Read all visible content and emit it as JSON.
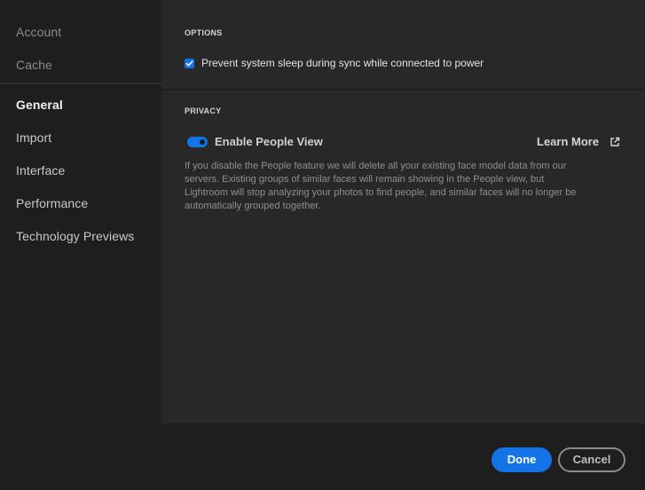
{
  "sidebar": {
    "items": [
      {
        "label": "Account",
        "state": "muted"
      },
      {
        "label": "Cache",
        "state": "muted"
      },
      {
        "label": "General",
        "state": "active"
      },
      {
        "label": "Import",
        "state": "normal"
      },
      {
        "label": "Interface",
        "state": "normal"
      },
      {
        "label": "Performance",
        "state": "normal"
      },
      {
        "label": "Technology Previews",
        "state": "normal"
      }
    ]
  },
  "options": {
    "title": "OPTIONS",
    "prevent_sleep": {
      "label": "Prevent system sleep during sync while connected to power",
      "checked": true
    }
  },
  "privacy": {
    "title": "PRIVACY",
    "people_view": {
      "label": "Enable People View",
      "enabled": true
    },
    "learn_more": "Learn More",
    "description": "If you disable the People feature we will delete all your existing face model data from our servers. Existing groups of similar faces will remain showing in the People view, but Lightroom will stop analyzing your photos to find people, and similar faces will no longer be automatically grouped together."
  },
  "footer": {
    "done_label": "Done",
    "cancel_label": "Cancel"
  },
  "colors": {
    "accent": "#1473e6",
    "panel": "#282828",
    "background": "#1e1e1e"
  }
}
